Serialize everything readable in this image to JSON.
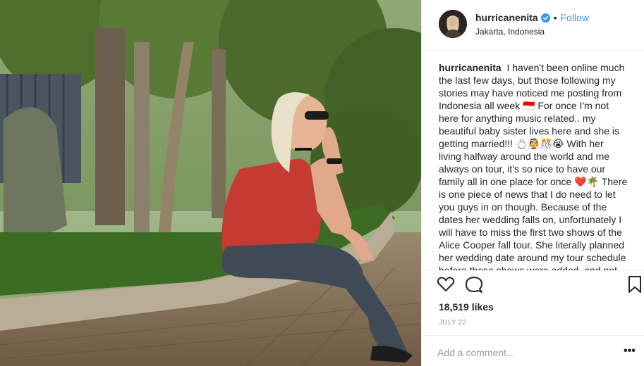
{
  "post": {
    "username": "hurricanenita",
    "follow_label": "Follow",
    "dot": "•",
    "location": "Jakarta, Indonesia",
    "caption": "I haven't been online much the last few days, but those following my stories may have noticed me posting from Indonesia all week 🇮🇩 For once I'm not here for anything music related.. my beautiful baby sister lives here and she is getting married!!! 💍👰🎊😭 With her living halfway around the world and me always on tour, it's so nice to have our family all in one place for once ❤️🌴 There is one piece of news that I do need to let you guys in on though. Because of the dates her wedding falls on, unfortunately I will have to miss the first two shows of the Alice Cooper fall tour. She literally planned her wedding date around my tour schedule before those shows were added, and not being here",
    "likes": "18,519 likes",
    "date": "JULY 22",
    "comment_placeholder": "Add a comment...",
    "more_label": "•••"
  },
  "icons": {
    "verified": "verified-badge-icon",
    "like": "heart-icon",
    "comment": "comment-bubble-icon",
    "save": "bookmark-icon",
    "more": "more-options-icon"
  },
  "colors": {
    "link_blue": "#3897f0",
    "verified_blue": "#3897f0",
    "secondary_text": "#999999",
    "divider": "#efefef"
  }
}
